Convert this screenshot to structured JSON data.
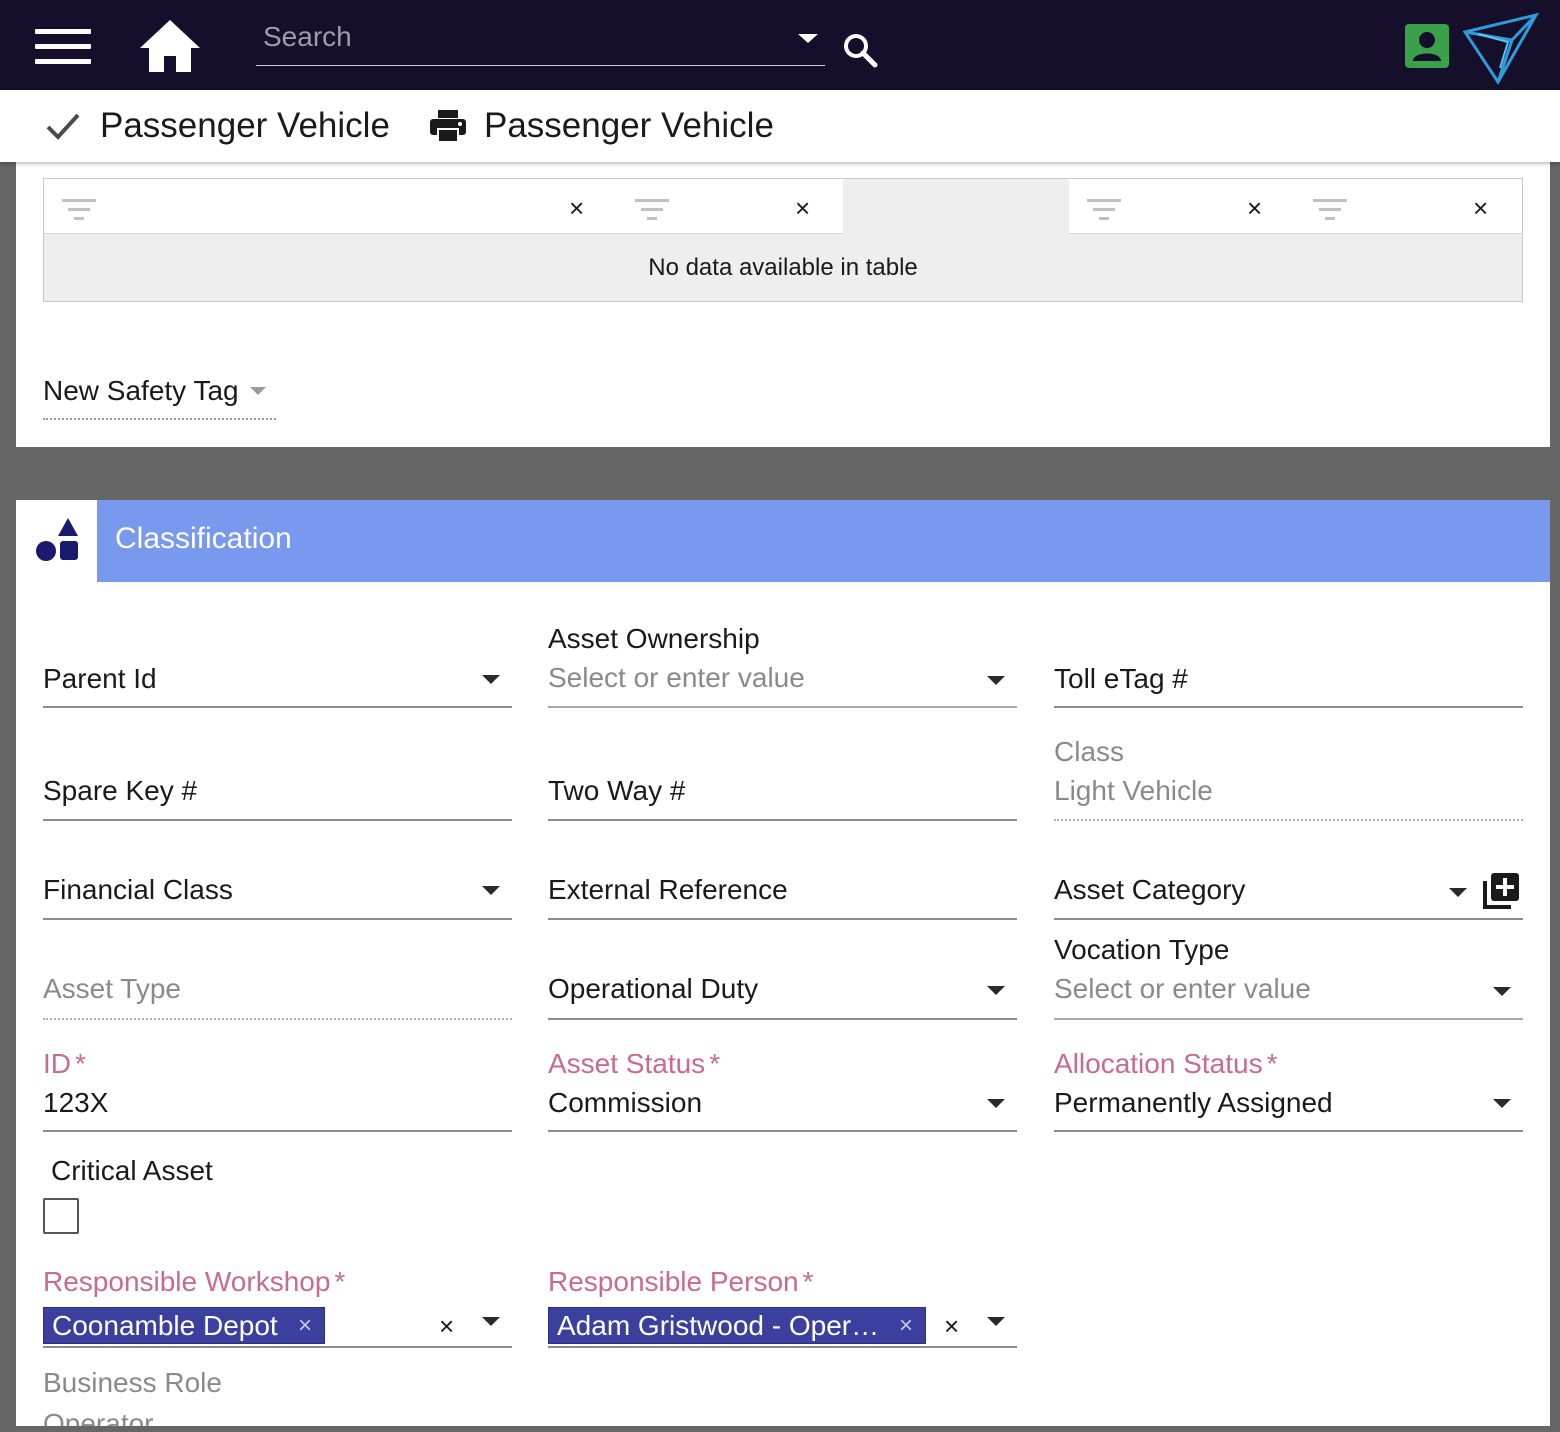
{
  "header": {
    "search_placeholder": "Search",
    "icons": [
      "menu-icon",
      "home-icon",
      "search-icon",
      "user-icon",
      "logo-icon"
    ]
  },
  "subheader": {
    "items": [
      {
        "icon": "check-icon",
        "label": "Passenger Vehicle"
      },
      {
        "icon": "print-icon",
        "label": "Passenger Vehicle"
      }
    ]
  },
  "safety_table": {
    "empty_message": "No data available in table"
  },
  "new_safety_tag": {
    "label": "New Safety Tag"
  },
  "classification": {
    "title": "Classification",
    "fields": {
      "parent_id": {
        "label": "Parent Id"
      },
      "asset_ownership": {
        "label": "Asset Ownership",
        "placeholder": "Select or enter value"
      },
      "toll_etag": {
        "label": "Toll eTag #"
      },
      "spare_key": {
        "label": "Spare Key #"
      },
      "two_way": {
        "label": "Two Way #"
      },
      "class": {
        "label": "Class",
        "value": "Light Vehicle"
      },
      "financial_class": {
        "label": "Financial Class"
      },
      "external_reference": {
        "label": "External Reference"
      },
      "asset_category": {
        "label": "Asset Category"
      },
      "asset_type": {
        "label": "Asset Type"
      },
      "operational_duty": {
        "label": "Operational Duty"
      },
      "vocation_type": {
        "label": "Vocation Type",
        "placeholder": "Select or enter value"
      },
      "id": {
        "label": "ID",
        "required_mark": "*",
        "value": "123X"
      },
      "asset_status": {
        "label": "Asset Status",
        "required_mark": "*",
        "value": "Commission"
      },
      "allocation_status": {
        "label": "Allocation Status",
        "required_mark": "*",
        "value": "Permanently Assigned"
      },
      "critical_asset": {
        "label": "Critical Asset",
        "checked": false
      },
      "responsible_workshop": {
        "label": "Responsible Workshop",
        "required_mark": "*",
        "chip": "Coonamble Depot",
        "chip_remove": "×",
        "clear": "×"
      },
      "responsible_person": {
        "label": "Responsible Person",
        "required_mark": "*",
        "chip": "Adam Gristwood - Oper…",
        "chip_remove": "×",
        "clear": "×"
      },
      "business_role": {
        "label": "Business Role",
        "value": "Operator"
      }
    }
  },
  "colors": {
    "topbar": "#150f2c",
    "section_header": "#7899ee",
    "required_label": "#c86b8d",
    "chip": "#3b3f9e",
    "user_icon": "#3aa04a",
    "logo": "#2f9bd8"
  }
}
